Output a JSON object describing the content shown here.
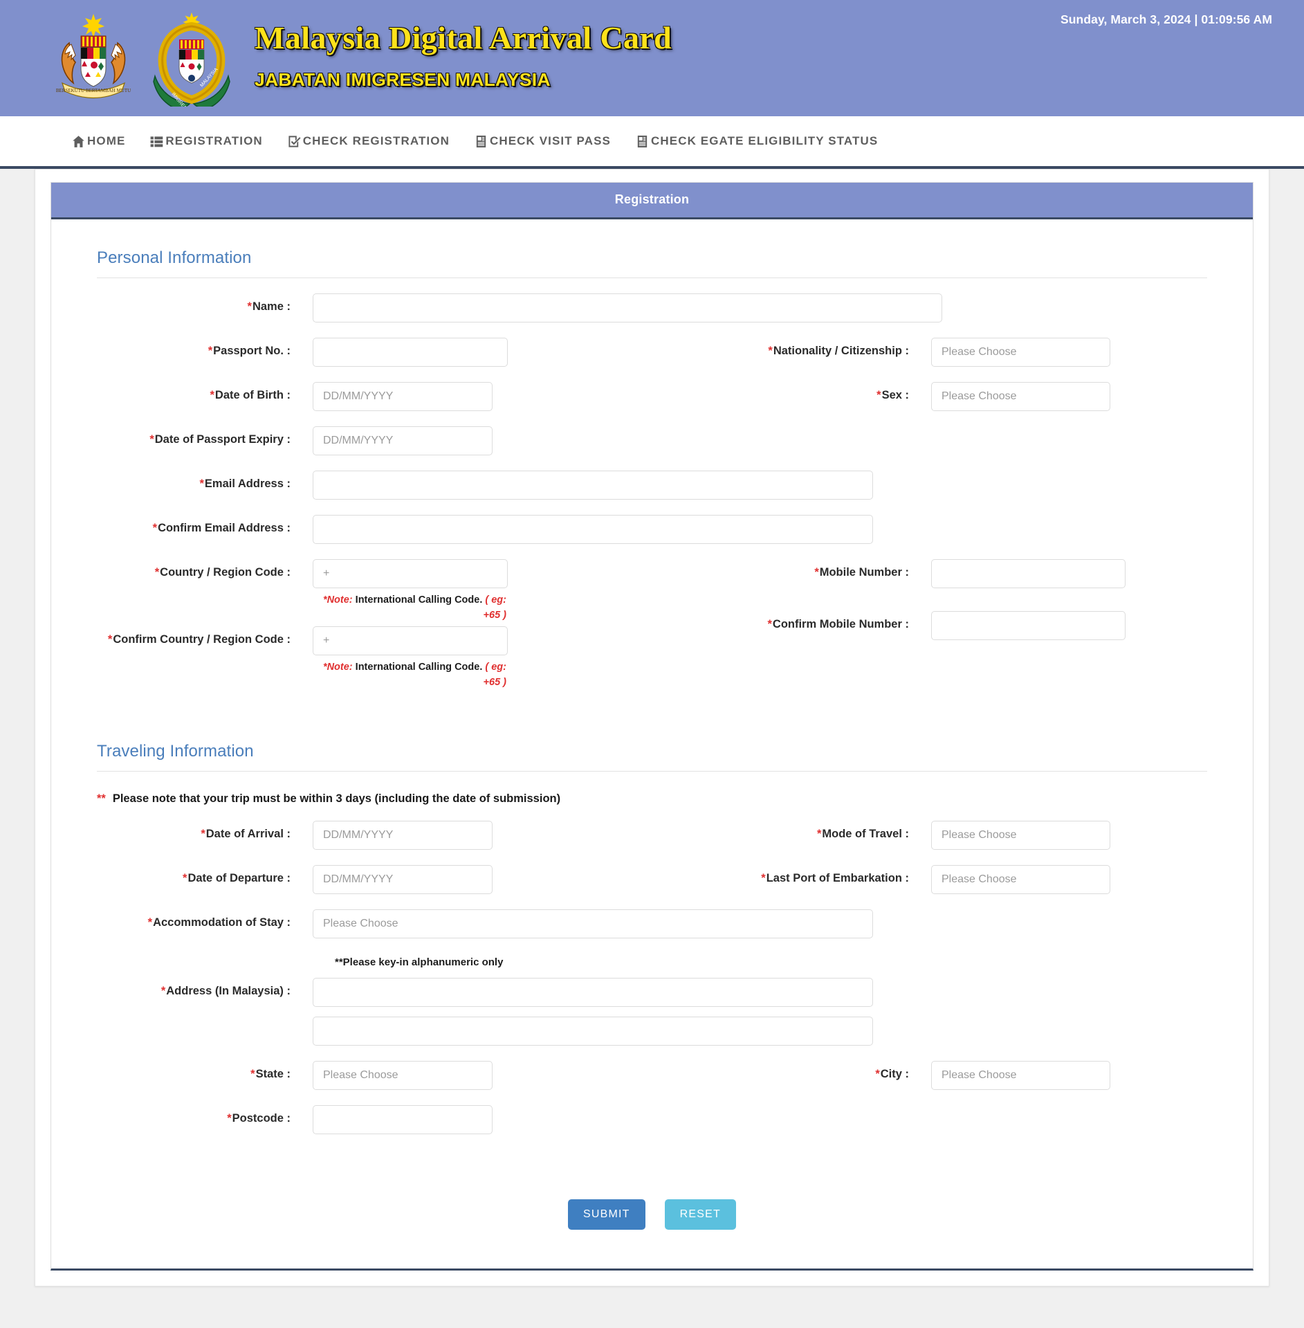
{
  "header": {
    "title": "Malaysia Digital Arrival Card",
    "subtitle": "JABATAN IMIGRESEN MALAYSIA",
    "datetime": "Sunday, March 3, 2024 | 01:09:56 AM",
    "banner_color": "#8090cc",
    "title_color": "#ffe21a"
  },
  "nav": {
    "items": [
      {
        "label": "HOME",
        "icon": "home-icon"
      },
      {
        "label": "REGISTRATION",
        "icon": "list-icon"
      },
      {
        "label": "CHECK REGISTRATION",
        "icon": "check-square-icon"
      },
      {
        "label": "CHECK VISIT PASS",
        "icon": "document-icon"
      },
      {
        "label": "CHECK EGATE ELIGIBILITY STATUS",
        "icon": "document-icon"
      }
    ]
  },
  "panel": {
    "title": "Registration"
  },
  "sections": {
    "personal": {
      "title": "Personal Information",
      "fields": {
        "name": {
          "label": "Name :",
          "value": "",
          "placeholder": ""
        },
        "passport_no": {
          "label": "Passport No. :",
          "value": "",
          "placeholder": ""
        },
        "nationality": {
          "label": "Nationality / Citizenship :",
          "value": "Please Choose"
        },
        "dob": {
          "label": "Date of Birth :",
          "value": "",
          "placeholder": "DD/MM/YYYY"
        },
        "sex": {
          "label": "Sex :",
          "value": "Please Choose"
        },
        "passport_expiry": {
          "label": "Date of Passport Expiry :",
          "value": "",
          "placeholder": "DD/MM/YYYY"
        },
        "email": {
          "label": "Email Address :",
          "value": "",
          "placeholder": ""
        },
        "confirm_email": {
          "label": "Confirm Email Address :",
          "value": "",
          "placeholder": ""
        },
        "country_code": {
          "label": "Country / Region Code :",
          "value": "",
          "placeholder": "+"
        },
        "mobile": {
          "label": "Mobile Number :",
          "value": "",
          "placeholder": ""
        },
        "confirm_country_code": {
          "label": "Confirm Country / Region Code :",
          "value": "",
          "placeholder": "+"
        },
        "confirm_mobile": {
          "label": "Confirm Mobile Number :",
          "value": "",
          "placeholder": ""
        }
      },
      "note": {
        "prefix": "*Note:",
        "body": "International Calling Code.",
        "example": "( eg: +65 )"
      }
    },
    "traveling": {
      "title": "Traveling Information",
      "trip_note_stars": "**",
      "trip_note": "Please note that your trip must be within 3 days (including the date of submission)",
      "alphanumeric_note": "**Please key-in alphanumeric only",
      "fields": {
        "arrival": {
          "label": "Date of Arrival :",
          "value": "",
          "placeholder": "DD/MM/YYYY"
        },
        "mode_of_travel": {
          "label": "Mode of Travel :",
          "value": "Please Choose"
        },
        "departure": {
          "label": "Date of Departure :",
          "value": "",
          "placeholder": "DD/MM/YYYY"
        },
        "last_port": {
          "label": "Last Port of Embarkation :",
          "value": "Please Choose"
        },
        "accommodation": {
          "label": "Accommodation of Stay :",
          "value": "Please Choose"
        },
        "address1": {
          "label": "Address (In Malaysia) :",
          "value": "",
          "placeholder": ""
        },
        "address2": {
          "label": "",
          "value": "",
          "placeholder": ""
        },
        "state": {
          "label": "State :",
          "value": "Please Choose"
        },
        "city": {
          "label": "City :",
          "value": "Please Choose"
        },
        "postcode": {
          "label": "Postcode :",
          "value": "",
          "placeholder": ""
        }
      }
    }
  },
  "buttons": {
    "submit": "SUBMIT",
    "reset": "RESET",
    "submit_color": "#3f7fc1",
    "reset_color": "#5bc0de"
  }
}
